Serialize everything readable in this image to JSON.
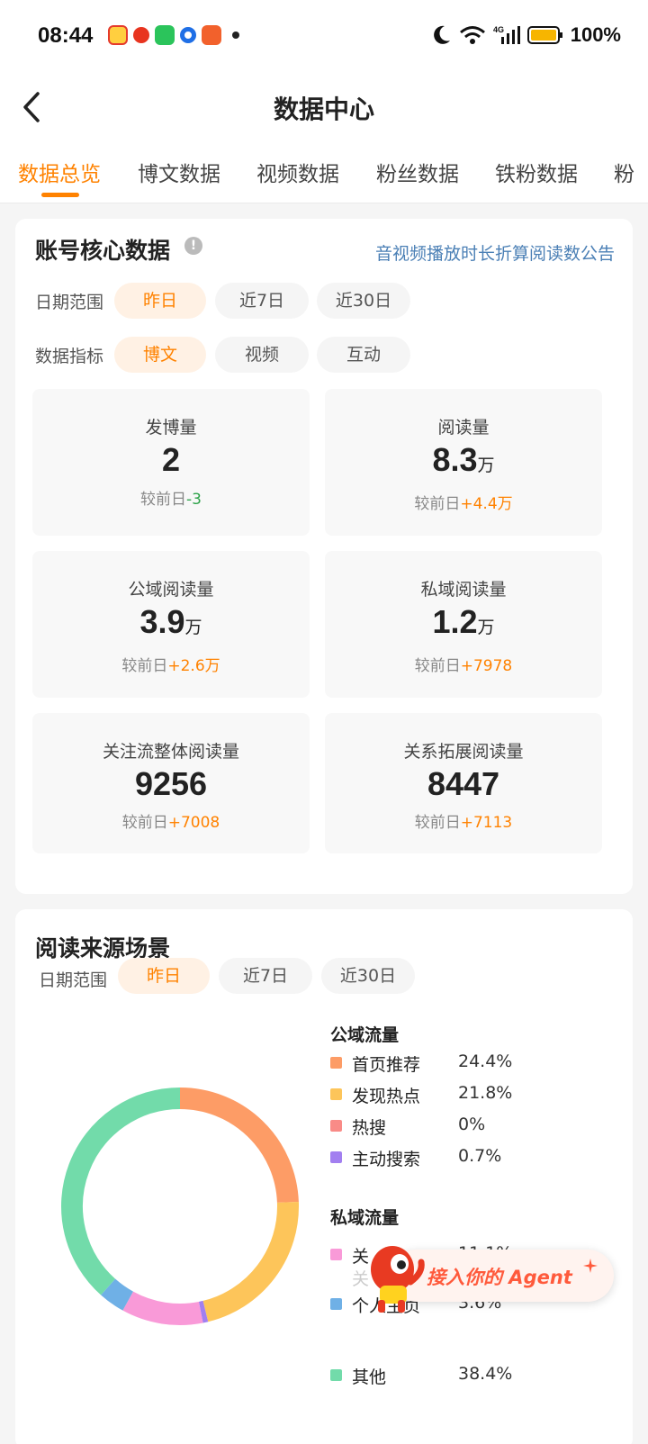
{
  "status_bar": {
    "time": "08:44",
    "battery": "100%",
    "network": "4G",
    "app_icons": [
      "weibo-icon",
      "red-app-icon",
      "wechat-icon",
      "blue-app-icon",
      "orange-app-icon"
    ]
  },
  "header": {
    "title": "数据中心"
  },
  "tabs": [
    {
      "label": "数据总览",
      "active": true
    },
    {
      "label": "博文数据",
      "active": false
    },
    {
      "label": "视频数据",
      "active": false
    },
    {
      "label": "粉丝数据",
      "active": false
    },
    {
      "label": "铁粉数据",
      "active": false
    },
    {
      "label": "粉",
      "active": false
    }
  ],
  "core": {
    "title": "账号核心数据",
    "notice": "音视频播放时长折算阅读数公告",
    "date_label": "日期范围",
    "date_chips": [
      "昨日",
      "近7日",
      "近30日"
    ],
    "metric_label": "数据指标",
    "metric_chips": [
      "博文",
      "视频",
      "互动"
    ],
    "stats": [
      {
        "label": "发博量",
        "value": "2",
        "unit": "",
        "compare_prefix": "较前日",
        "compare": "-3"
      },
      {
        "label": "阅读量",
        "value": "8.3",
        "unit": "万",
        "compare_prefix": "较前日",
        "compare": "+4.4万"
      },
      {
        "label": "公域阅读量",
        "value": "3.9",
        "unit": "万",
        "compare_prefix": "较前日",
        "compare": "+2.6万"
      },
      {
        "label": "私域阅读量",
        "value": "1.2",
        "unit": "万",
        "compare_prefix": "较前日",
        "compare": "+7978"
      },
      {
        "label": "关注流整体阅读量",
        "value": "9256",
        "unit": "",
        "compare_prefix": "较前日",
        "compare": "+7008"
      },
      {
        "label": "关系拓展阅读量",
        "value": "8447",
        "unit": "",
        "compare_prefix": "较前日",
        "compare": "+7113"
      }
    ]
  },
  "source": {
    "title": "阅读来源场景",
    "date_label": "日期范围",
    "date_chips": [
      "昨日",
      "近7日",
      "近30日"
    ],
    "public_group": "公域流量",
    "private_group": "私域流量"
  },
  "agent": {
    "label": "接入你的 Agent"
  },
  "colors": {
    "accent": "#ff8200",
    "home": "#fd9c66",
    "discover": "#fdc55a",
    "hot": "#f98b87",
    "search": "#a27ff0",
    "follow": "#f99ad8",
    "personal": "#6fb0e6",
    "other": "#72dbaa"
  },
  "chart_data": {
    "type": "pie",
    "donut": true,
    "series": [
      {
        "name": "首页推荐",
        "value": 24.4,
        "label": "24.4%",
        "color": "#fd9c66",
        "group": "public"
      },
      {
        "name": "发现热点",
        "value": 21.8,
        "label": "21.8%",
        "color": "#fdc55a",
        "group": "public"
      },
      {
        "name": "热搜",
        "value": 0,
        "label": "0%",
        "color": "#f98b87",
        "group": "public"
      },
      {
        "name": "主动搜索",
        "value": 0.7,
        "label": "0.7%",
        "color": "#a27ff0",
        "group": "public"
      },
      {
        "name": "关",
        "value": 11.1,
        "label": "11.1%",
        "color": "#f99ad8",
        "group": "private"
      },
      {
        "name": "关",
        "value": 0,
        "label": "",
        "color": "#ffffff",
        "group": "private"
      },
      {
        "name": "个人主页",
        "value": 3.6,
        "label": "3.6%",
        "color": "#6fb0e6",
        "group": "private"
      },
      {
        "name": "其他",
        "value": 38.4,
        "label": "38.4%",
        "color": "#72dbaa",
        "group": "other"
      }
    ]
  }
}
